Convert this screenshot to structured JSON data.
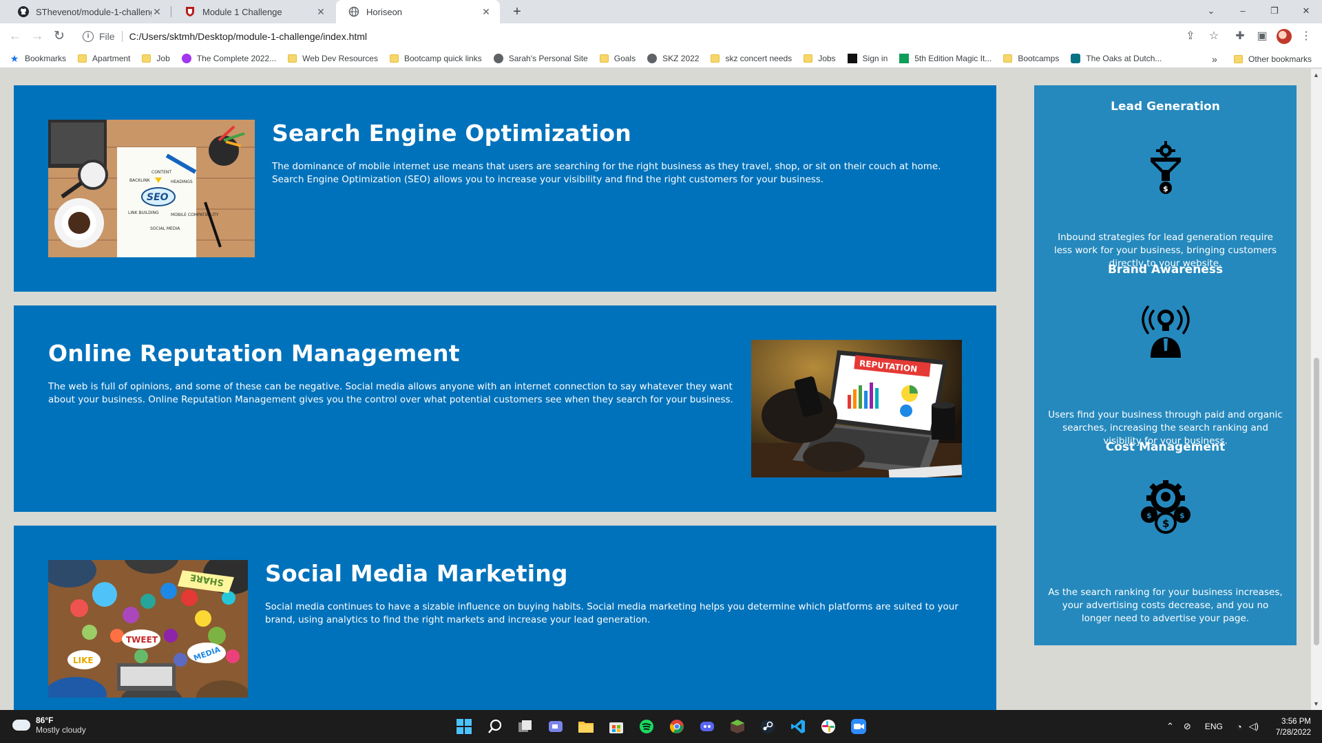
{
  "browser": {
    "tabs": [
      {
        "label": "SThevenot/module-1-challenge",
        "icon": "github-icon",
        "active": false
      },
      {
        "label": "Module 1 Challenge",
        "icon": "shield-icon",
        "active": false
      },
      {
        "label": "Horiseon",
        "icon": "globe-icon",
        "active": true
      }
    ],
    "address": {
      "scheme": "File",
      "url": "C:/Users/sktmh/Desktop/module-1-challenge/index.html"
    },
    "bookmarks": [
      {
        "label": "Bookmarks",
        "icon": "star-icon"
      },
      {
        "label": "Apartment",
        "icon": "folder-icon"
      },
      {
        "label": "Job",
        "icon": "folder-icon"
      },
      {
        "label": "The Complete 2022...",
        "icon": "udemy-icon"
      },
      {
        "label": "Web Dev Resources",
        "icon": "folder-icon"
      },
      {
        "label": "Bootcamp quick links",
        "icon": "folder-icon"
      },
      {
        "label": "Sarah's Personal Site",
        "icon": "globe-icon"
      },
      {
        "label": "Goals",
        "icon": "folder-icon"
      },
      {
        "label": "SKZ 2022",
        "icon": "globe-icon"
      },
      {
        "label": "skz concert needs",
        "icon": "folder-icon"
      },
      {
        "label": "Jobs",
        "icon": "folder-icon"
      },
      {
        "label": "Sign in",
        "icon": "ibm-icon"
      },
      {
        "label": "5th Edition Magic It...",
        "icon": "sheets-icon"
      },
      {
        "label": "Bootcamps",
        "icon": "folder-icon"
      },
      {
        "label": "The Oaks at Dutch...",
        "icon": "link-icon"
      }
    ],
    "bookmarks_more": "»",
    "other_bookmarks": "Other bookmarks"
  },
  "page": {
    "cards": [
      {
        "title": "Search Engine Optimization",
        "text": "The dominance of mobile internet use means that users are searching for the right business as they travel, shop, or sit on their couch at home. Search Engine Optimization (SEO) allows you to increase your visibility and find the right customers for your business.",
        "image_words": [
          "SEO",
          "CONTENT",
          "BACKLINK",
          "HEADINGS",
          "LINK BUILDING",
          "MOBILE COMPATIBILITY",
          "SOCIAL MEDIA"
        ]
      },
      {
        "title": "Online Reputation Management",
        "text": "The web is full of opinions, and some of these can be negative. Social media allows anyone with an internet connection to say whatever they want about your business. Online Reputation Management gives you the control over what potential customers see when they search for your business.",
        "image_words": [
          "REPUTATION"
        ]
      },
      {
        "title": "Social Media Marketing",
        "text": "Social media continues to have a sizable influence on buying habits. Social media marketing helps you determine which platforms are suited to your brand, using analytics to find the right markets and increase your lead generation.",
        "image_words": [
          "SHARE",
          "TWEET",
          "LIKE",
          "MEDIA"
        ]
      }
    ],
    "benefits": [
      {
        "title": "Lead Generation",
        "icon": "funnel-icon",
        "text": "Inbound strategies for lead generation require less work for your business, bringing customers directly to your website."
      },
      {
        "title": "Brand Awareness",
        "icon": "lightbulb-broadcast-icon",
        "text": "Users find your business through paid and organic searches, increasing the search ranking and visibility for your business."
      },
      {
        "title": "Cost Management",
        "icon": "gear-coins-icon",
        "text": "As the search ranking for your business increases, your advertising costs decrease, and you no longer need to advertise your page."
      }
    ],
    "colors": {
      "card_blue": "#0072bb",
      "sidebar_blue": "#2589bd",
      "page_bg": "#d9d9d4"
    }
  },
  "taskbar": {
    "weather": {
      "temp": "86°F",
      "condition": "Mostly cloudy"
    },
    "apps": [
      "start-icon",
      "search-icon",
      "task-view-icon",
      "teams-chat-icon",
      "file-explorer-icon",
      "store-icon",
      "spotify-icon",
      "chrome-icon",
      "discord-icon",
      "minecraft-icon",
      "steam-icon",
      "vscode-icon",
      "slack-icon",
      "zoom-icon"
    ],
    "language": "ENG",
    "time": "3:56 PM",
    "date": "7/28/2022"
  }
}
